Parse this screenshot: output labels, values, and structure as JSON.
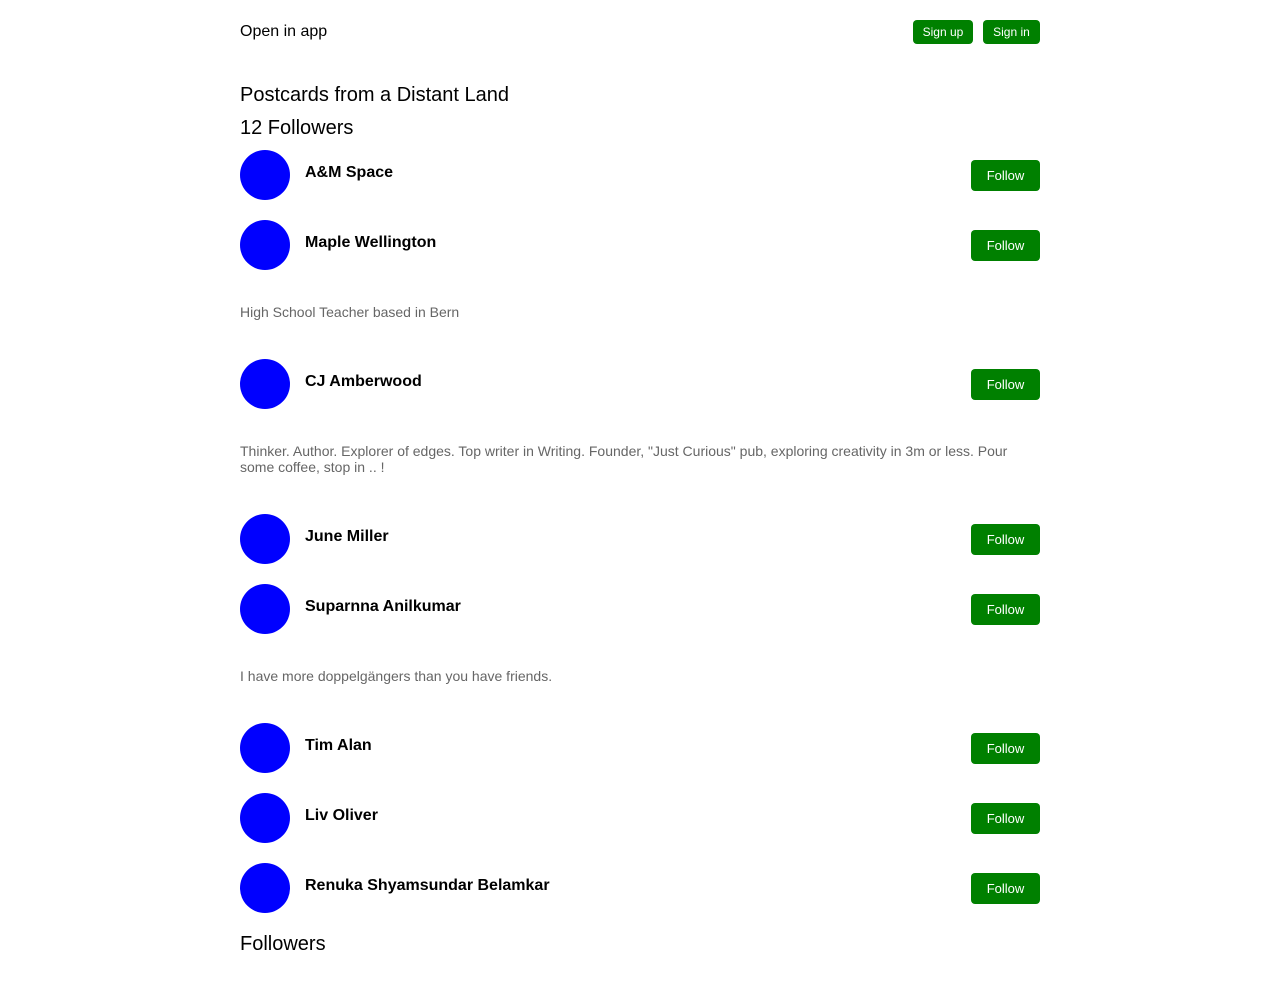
{
  "topbar": {
    "open_in_app": "Open in app",
    "sign_up": "Sign up",
    "sign_in": "Sign in"
  },
  "publication": {
    "title": "Postcards from a Distant Land",
    "followers_heading": "12 Followers"
  },
  "followers": [
    {
      "name": "A&M Space",
      "button": "Follow",
      "bio": ""
    },
    {
      "name": "Maple Wellington",
      "button": "Follow",
      "bio": "High School Teacher based in Bern"
    },
    {
      "name": "CJ Amberwood",
      "button": "Follow",
      "bio": "Thinker. Author. Explorer of edges. Top writer in Writing. Founder, \"Just Curious\" pub, exploring creativity in 3m or less. Pour some coffee, stop in .. !"
    },
    {
      "name": "June Miller",
      "button": "Follow",
      "bio": ""
    },
    {
      "name": "Suparnna Anilkumar",
      "button": "Follow",
      "bio": "I have more doppelgängers than you have friends."
    },
    {
      "name": "Tim Alan",
      "button": "Follow",
      "bio": ""
    },
    {
      "name": "Liv Oliver",
      "button": "Follow",
      "bio": ""
    },
    {
      "name": "Renuka Shyamsundar Belamkar",
      "button": "Follow",
      "bio": ""
    }
  ],
  "footer": {
    "label": "Followers"
  },
  "colors": {
    "button_bg": "#008000",
    "avatar": "#0000ff",
    "bio_text": "#666666"
  }
}
